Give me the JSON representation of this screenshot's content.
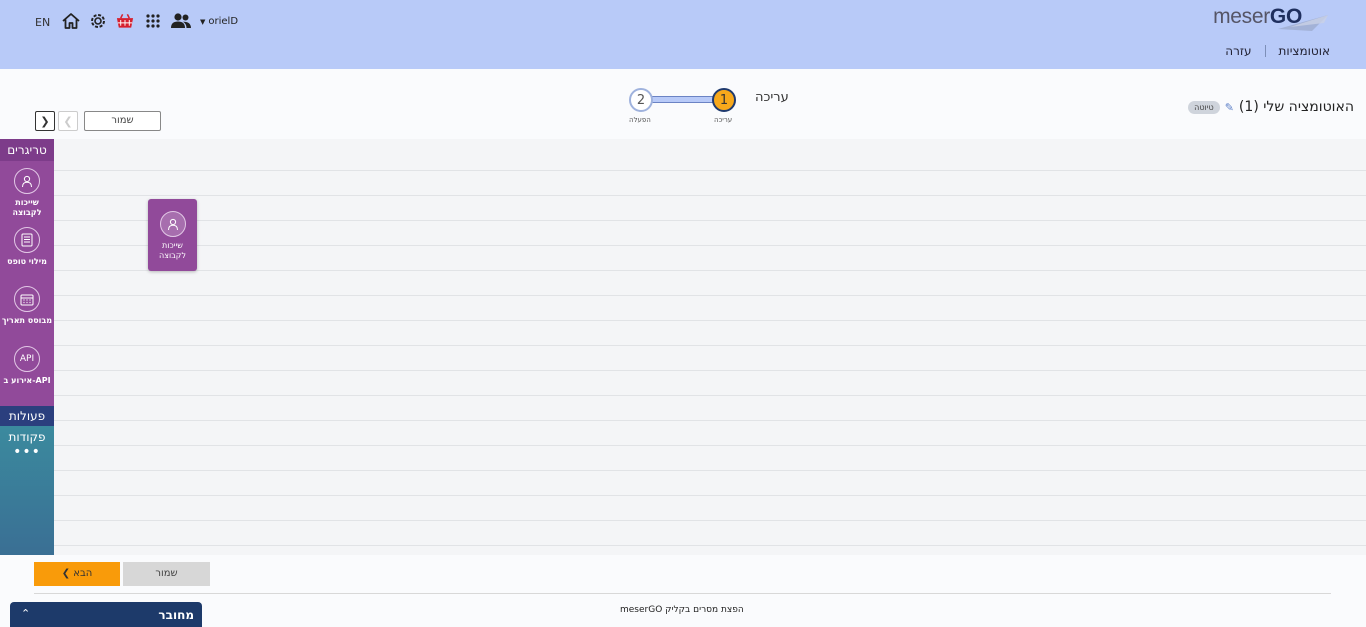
{
  "header": {
    "lang": "EN",
    "user_name": "orielD",
    "logo": {
      "prefix": "meser",
      "suffix": "GO"
    },
    "nav": [
      "אוטומציות",
      "עזרה"
    ],
    "icons": [
      "home-icon",
      "gear-icon",
      "basket-icon",
      "apps-grid-icon",
      "users-icon"
    ]
  },
  "page": {
    "title": "האוטומציה שלי (1)",
    "status_badge": "טיוטה",
    "save_label": "שמור"
  },
  "stepper": {
    "current_label": "עריכה",
    "steps": [
      {
        "number": "1",
        "caption": "עריכה",
        "active": true
      },
      {
        "number": "2",
        "caption": "הפעלה",
        "active": false
      }
    ]
  },
  "sidebar": {
    "triggers_title": "טריגרים",
    "triggers": [
      {
        "label": "שייכות לקבוצה",
        "icon": "group-membership-icon"
      },
      {
        "label": "מילוי טופס",
        "icon": "form-icon"
      },
      {
        "label": "מבוסס תאריך",
        "icon": "calendar-icon"
      },
      {
        "label": "אירוע ב-API",
        "icon_text": "API"
      }
    ],
    "actions_title": "פעולות",
    "commands_title": "פקודות",
    "more": "•••"
  },
  "canvas": {
    "nodes": [
      {
        "label": "שייכות לקבוצה",
        "icon": "group-membership-icon"
      }
    ]
  },
  "footer": {
    "next_label": "הבא",
    "save_label": "שמור",
    "tagline": "meserGO הפצת מסרים בקליק",
    "status_label": "מחובר"
  },
  "colors": {
    "header_bg": "#b8caf8",
    "triggers": "#914a9a",
    "actions": "#2b3f7e",
    "commands": "#3a7f9a",
    "primary_button": "#f99b0a",
    "status_bar": "#1d3a6a"
  }
}
